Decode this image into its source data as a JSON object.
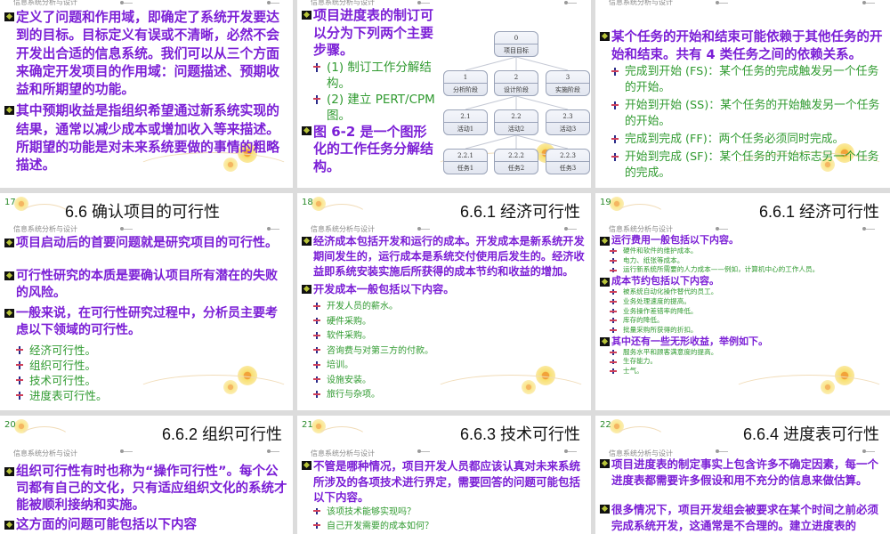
{
  "header": "信息系统分析与设计",
  "slides": [
    {
      "number": null,
      "title": null,
      "row": "top",
      "blocks": [
        {
          "type": "b",
          "text": "定义了问题和作用域，即确定了系统开发要达到的目标。目标定义有误或不清晰，必然不会开发出合适的信息系统。我们可以从三个方面来确定开发项目的作用域：问题描述、预期收益和所期望的功能。"
        },
        {
          "type": "b",
          "text": "其中预期收益是指组织希望通过新系统实现的结果，通常以减少成本或增加收入等来描述。所期望的功能是对未来系统要做的事情的粗略描述。"
        }
      ]
    },
    {
      "number": null,
      "title": null,
      "row": "top",
      "blocks": [
        {
          "type": "b",
          "text": "项目进度表的制订可以分为下列两个主要步骤。"
        },
        {
          "type": "s",
          "text": "(1)  制订工作分解结构。"
        },
        {
          "type": "s",
          "text": "(2) 建立 PERT/CPM 图。"
        },
        {
          "type": "b",
          "text": "图 6-2 是一个图形化的工作任务分解结构。"
        }
      ],
      "wbs": [
        {
          "id": "0",
          "label": "项目目标"
        },
        {
          "id": "1",
          "label": "分析阶段"
        },
        {
          "id": "2",
          "label": "设计阶段"
        },
        {
          "id": "3",
          "label": "实施阶段"
        },
        {
          "id": "2.1",
          "label": "活动1"
        },
        {
          "id": "2.2",
          "label": "活动2"
        },
        {
          "id": "2.3",
          "label": "活动3"
        },
        {
          "id": "2.2.1",
          "label": "任务1"
        },
        {
          "id": "2.2.2",
          "label": "任务2"
        },
        {
          "id": "2.2.3",
          "label": "任务3"
        }
      ]
    },
    {
      "number": null,
      "title": null,
      "row": "top",
      "blocks": [
        {
          "type": "b",
          "text": "某个任务的开始和结束可能依赖于其他任务的开始和结束。共有 4 类任务之间的依赖关系。"
        },
        {
          "type": "s",
          "text": "完成到开始 (FS)：某个任务的完成触发另一个任务的开始。"
        },
        {
          "type": "s",
          "text": "开始到开始 (SS)：某个任务的开始触发另一个任务的开始。"
        },
        {
          "type": "s",
          "text": "完成到完成 (FF)：两个任务必须同时完成。"
        },
        {
          "type": "s",
          "text": "开始到完成 (SF)：某个任务的开始标志另一个任务的完成。"
        }
      ]
    },
    {
      "number": "17",
      "title": "6.6   确认项目的可行性",
      "row": "mid",
      "blocks": [
        {
          "type": "b",
          "gap": true,
          "text": "项目启动后的首要问题就是研究项目的可行性。"
        },
        {
          "type": "b",
          "text": "可行性研究的本质是要确认项目所有潜在的失败的风险。"
        },
        {
          "type": "b",
          "text": "一般来说，在可行性研究过程中，分析员主要考虑以下领域的可行性。"
        },
        {
          "type": "s",
          "text": "经济可行性。"
        },
        {
          "type": "s",
          "text": "组织可行性。"
        },
        {
          "type": "s",
          "text": "技术可行性。"
        },
        {
          "type": "s",
          "text": "进度表可行性。"
        }
      ]
    },
    {
      "number": "18",
      "title": "6.6.1   经济可行性",
      "row": "mid",
      "blocks": [
        {
          "type": "b",
          "text": "经济成本包括开发和运行的成本。开发成本是新系统开发期间发生的，运行成本是系统交付使用后发生的。经济收益即系统安装实施后所获得的成本节约和收益的增加。"
        },
        {
          "type": "b",
          "text": "开发成本一般包括以下内容。"
        },
        {
          "type": "s",
          "text": "开发人员的薪水。"
        },
        {
          "type": "s",
          "text": "硬件采购。"
        },
        {
          "type": "s",
          "text": "软件采购。"
        },
        {
          "type": "s",
          "text": "咨询费与对第三方的付款。"
        },
        {
          "type": "s",
          "text": "培训。"
        },
        {
          "type": "s",
          "text": "设施安装。"
        },
        {
          "type": "s",
          "text": "旅行与杂项。"
        }
      ]
    },
    {
      "number": "19",
      "title": "6.6.1   经济可行性",
      "row": "mid",
      "blocks": [
        {
          "type": "b",
          "text": "运行费用一般包括以下内容。"
        },
        {
          "type": "s",
          "text": "硬件和软件的维护成本。"
        },
        {
          "type": "s",
          "text": "电力、纸张等成本。"
        },
        {
          "type": "s",
          "text": "运行新系统所需要的人力成本——例如，计算机中心的工作人员。"
        },
        {
          "type": "b",
          "text": "成本节约包括以下内容。"
        },
        {
          "type": "s",
          "text": "被系统自动化操作替代的员工。"
        },
        {
          "type": "s",
          "text": "业务处理速度的提高。"
        },
        {
          "type": "s",
          "text": "业务操作差错率的降低。"
        },
        {
          "type": "s",
          "text": "库存的降低。"
        },
        {
          "type": "s",
          "text": "批量采购所获得的折扣。"
        },
        {
          "type": "b",
          "text": "其中还有一些无形收益，举例如下。"
        },
        {
          "type": "s",
          "text": "服务水平和顾客满意度的提高。"
        },
        {
          "type": "s",
          "text": "生存能力。"
        },
        {
          "type": "s",
          "text": "士气。"
        }
      ]
    },
    {
      "number": "20",
      "title": "6.6.2   组织可行性",
      "row": "bot",
      "blocks": [
        {
          "type": "b",
          "text": "组织可行性有时也称为“操作可行性”。每个公司都有自己的文化，只有适应组织文化的系统才能被顺利接纳和实施。"
        },
        {
          "type": "b",
          "text": "这方面的问题可能包括以下内容"
        }
      ]
    },
    {
      "number": "21",
      "title": "6.6.3   技术可行性",
      "row": "bot",
      "blocks": [
        {
          "type": "b",
          "text": "不管是哪种情况，项目开发人员都应该认真对未来系统所涉及的各项技术进行界定，需要回答的问题可能包括以下内容。"
        },
        {
          "type": "s",
          "text": "该项技术能够实现吗？"
        },
        {
          "type": "s",
          "text": "自己开发需要的成本如何？"
        }
      ]
    },
    {
      "number": "22",
      "title": "6.6.4   进度表可行性",
      "row": "bot",
      "blocks": [
        {
          "type": "b",
          "gap": true,
          "text": "项目进度表的制定事实上包含许多不确定因素，每一个进度表都需要许多假设和用不充分的信息来做估算。"
        },
        {
          "type": "b",
          "text": "很多情况下，项目开发组会被要求在某个时间之前必须完成系统开发，这通常是不合理的。建立进度表的"
        }
      ]
    }
  ]
}
